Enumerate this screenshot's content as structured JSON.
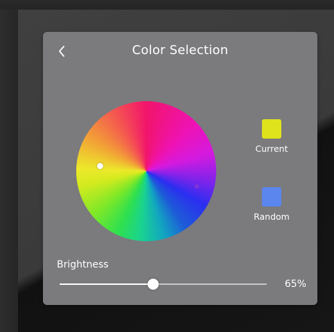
{
  "header": {
    "title": "Color Selection",
    "back_icon": "chevron-left-icon"
  },
  "color_wheel": {
    "selected_hue": "yellow"
  },
  "swatches": {
    "current": {
      "label": "Current",
      "color": "#dfe31b"
    },
    "random": {
      "label": "Random",
      "color": "#5a86ee"
    }
  },
  "brightness": {
    "label": "Brightness",
    "value": 0.45,
    "value_text": "65%"
  },
  "colors": {
    "panel": "#7b7a7d",
    "text": "#ffffff"
  }
}
